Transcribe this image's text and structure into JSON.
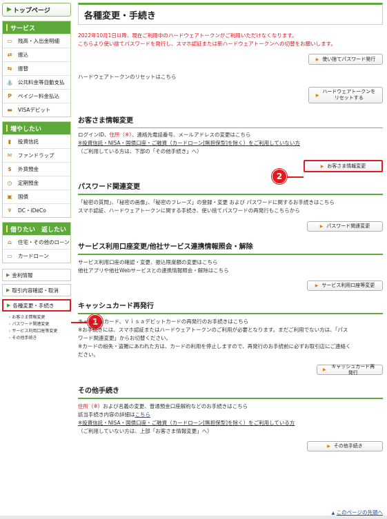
{
  "sidebar": {
    "top_page": "トップページ",
    "sections": [
      {
        "title": "サービス",
        "items": [
          {
            "label": "残高・入出金明細",
            "icon": "passbook-icon",
            "glyph": "▭",
            "color": "#c07a20"
          },
          {
            "label": "振込",
            "icon": "transfer-icon",
            "glyph": "⇄",
            "color": "#c07a20"
          },
          {
            "label": "振替",
            "icon": "exchange-icon",
            "glyph": "⇆",
            "color": "#c07a20"
          },
          {
            "label": "公共料金等自動支払",
            "icon": "faucet-icon",
            "glyph": "⛲",
            "color": "#c07a20"
          },
          {
            "label": "ペイジー料金払込",
            "icon": "pay-easy-icon",
            "glyph": "P",
            "color": "#c07a20"
          },
          {
            "label": "VISAデビット",
            "icon": "debit-card-icon",
            "glyph": "▬",
            "color": "#c07a20"
          }
        ]
      },
      {
        "title": "増やしたい",
        "items": [
          {
            "label": "投資信託",
            "icon": "bar-chart-icon",
            "glyph": "▮",
            "color": "#c07a20"
          },
          {
            "label": "ファンドラップ",
            "icon": "gift-icon",
            "glyph": "✉",
            "color": "#c07a20"
          },
          {
            "label": "外貨預金",
            "icon": "dollar-icon",
            "glyph": "$",
            "color": "#c07a20"
          },
          {
            "label": "定期預金",
            "icon": "clock-icon",
            "glyph": "◷",
            "color": "#c07a20"
          },
          {
            "label": "国債",
            "icon": "bond-icon",
            "glyph": "▣",
            "color": "#c07a20"
          },
          {
            "label": "DC・iDeCo",
            "icon": "sprout-icon",
            "glyph": "♆",
            "color": "#c07a20"
          }
        ]
      },
      {
        "title": "借りたい　返したい",
        "items": [
          {
            "label": "住宅・その他のローン",
            "icon": "house-icon",
            "glyph": "⌂",
            "color": "#c07a20"
          },
          {
            "label": "カードローン",
            "icon": "card-icon",
            "glyph": "▭",
            "color": "#c07a20"
          }
        ]
      }
    ],
    "plain_links": [
      "金利情報",
      "取引内容確認・取消"
    ],
    "active_link": "各種変更・手続き",
    "sub_links": [
      "お客さま情報変更",
      "パスワード関連変更",
      "サービス利用口座等変更",
      "その他手続き"
    ]
  },
  "main": {
    "title": "各種変更・手続き",
    "notice": [
      "2022年10月1日以降、現在ご利用中のハードウェアトークンがご利用いただけなくなります。",
      "こちらより使い捨てパスワードを発行し、スマホ認証または新ハードウェアトークンへの切替をお願いします。"
    ],
    "otp_button": "使い捨てパスワード発行",
    "hw_reset_text": "ハードウェアトークンのリセットはこちら",
    "hw_reset_button_l1": "ハードウェアトークンを",
    "hw_reset_button_l2": "リセットする",
    "sections": {
      "customer": {
        "title": "お客さま情報変更",
        "line1_a": "ログインID、",
        "line1_red": "住所（※）",
        "line1_b": "、連絡先電話番号、メールアドレスの変更はこちら",
        "line2": "※投資信託・NISA・国債口座・ご融資（カードローン[無担保型]を除く）をご利用していない方",
        "line3": "（ご利用している方は、下部の「その他手続き」へ）",
        "button": "お客さま情報変更"
      },
      "password": {
        "title": "パスワード関連変更",
        "line1": "「秘密の質問」、「秘密の画像」、「秘密のフレーズ」の登録・変更 および パスワードに関するお手続きはこちら",
        "line2": "スマホ認証、ハードウェアトークンに関する手続き、使い捨てパスワードの再発行もこちらから",
        "button": "パスワード関連変更"
      },
      "service": {
        "title": "サービス利用口座変更/他社サービス連携情報照会・解除",
        "line1": "サービス利用口座の確認・変更、振込限度額の変更はこちら",
        "line2": "他社アプリや他社Webサービスとの連携情報照会・解除はこちら",
        "button": "サービス利用口座等変更"
      },
      "cash_card": {
        "title": "キャッシュカード再発行",
        "line1": "キャッシュカード、Ｖｉｓａデビットカードの再発行のお手続きはこちら",
        "line2": "※お手続きには、スマホ認証またはハードウェアトークンのご利用が必要となります。まだご利用でない方は、「パス",
        "line3": "ワード関連変更」からお切替ください。",
        "line4": "※カードの紛失・盗難にあわれた方は、カードの利用を停止しますので、再発行のお手続前に必ずお取引店にご連絡く",
        "line5": "ださい。",
        "button": "キャッシュカード再発行"
      },
      "other": {
        "title": "その他手続き",
        "line1_red": "住所（※）",
        "line1_b": "および名義の変更、普通預金口座解約などのお手続きはこちら",
        "line2_a": "該当手続き内容の詳細は",
        "line2_link": "こちら",
        "line3": "※投資信託・NISA・国債口座・ご融資（カードローン[無担保型]を除く）をご利用している方",
        "line4": "（ご利用していない方は、上部「お客さま情報変更」へ）",
        "button": "その他手続き"
      }
    },
    "page_top": "このページの先頭へ"
  },
  "annotations": {
    "badge1": "1",
    "badge2": "2"
  },
  "colors": {
    "accent_green": "#5daa3a",
    "alert_red": "#e2191f",
    "text_red": "#d4141b",
    "link_blue": "#1a4ea1"
  }
}
